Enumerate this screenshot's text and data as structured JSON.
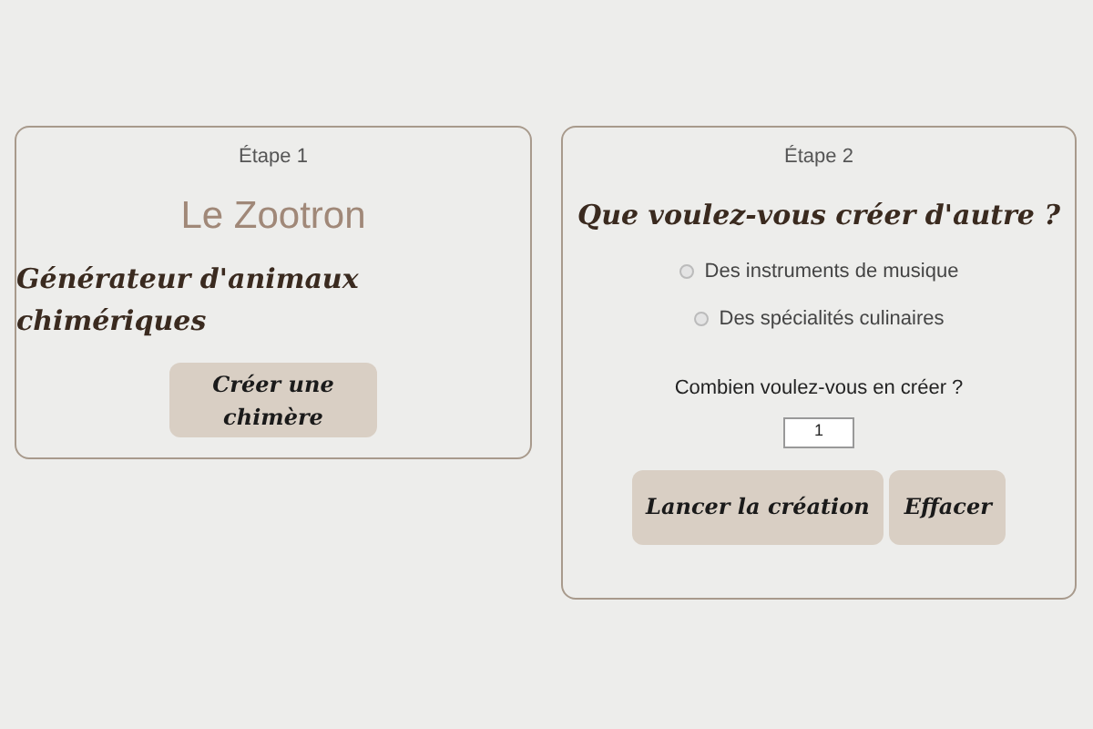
{
  "step1": {
    "step_label": "Étape 1",
    "title": "Le Zootron",
    "subtitle": "Générateur d'animaux chimériques",
    "button": "Créer une chimère"
  },
  "step2": {
    "step_label": "Étape 2",
    "question": "Que voulez-vous créer d'autre ?",
    "options": [
      {
        "label": "Des instruments de musique",
        "selected": false
      },
      {
        "label": "Des spécialités culinaires",
        "selected": false
      }
    ],
    "count_label": "Combien voulez-vous en créer ?",
    "count_value": "1",
    "buttons": [
      "Lancer la création",
      "Effacer"
    ]
  }
}
